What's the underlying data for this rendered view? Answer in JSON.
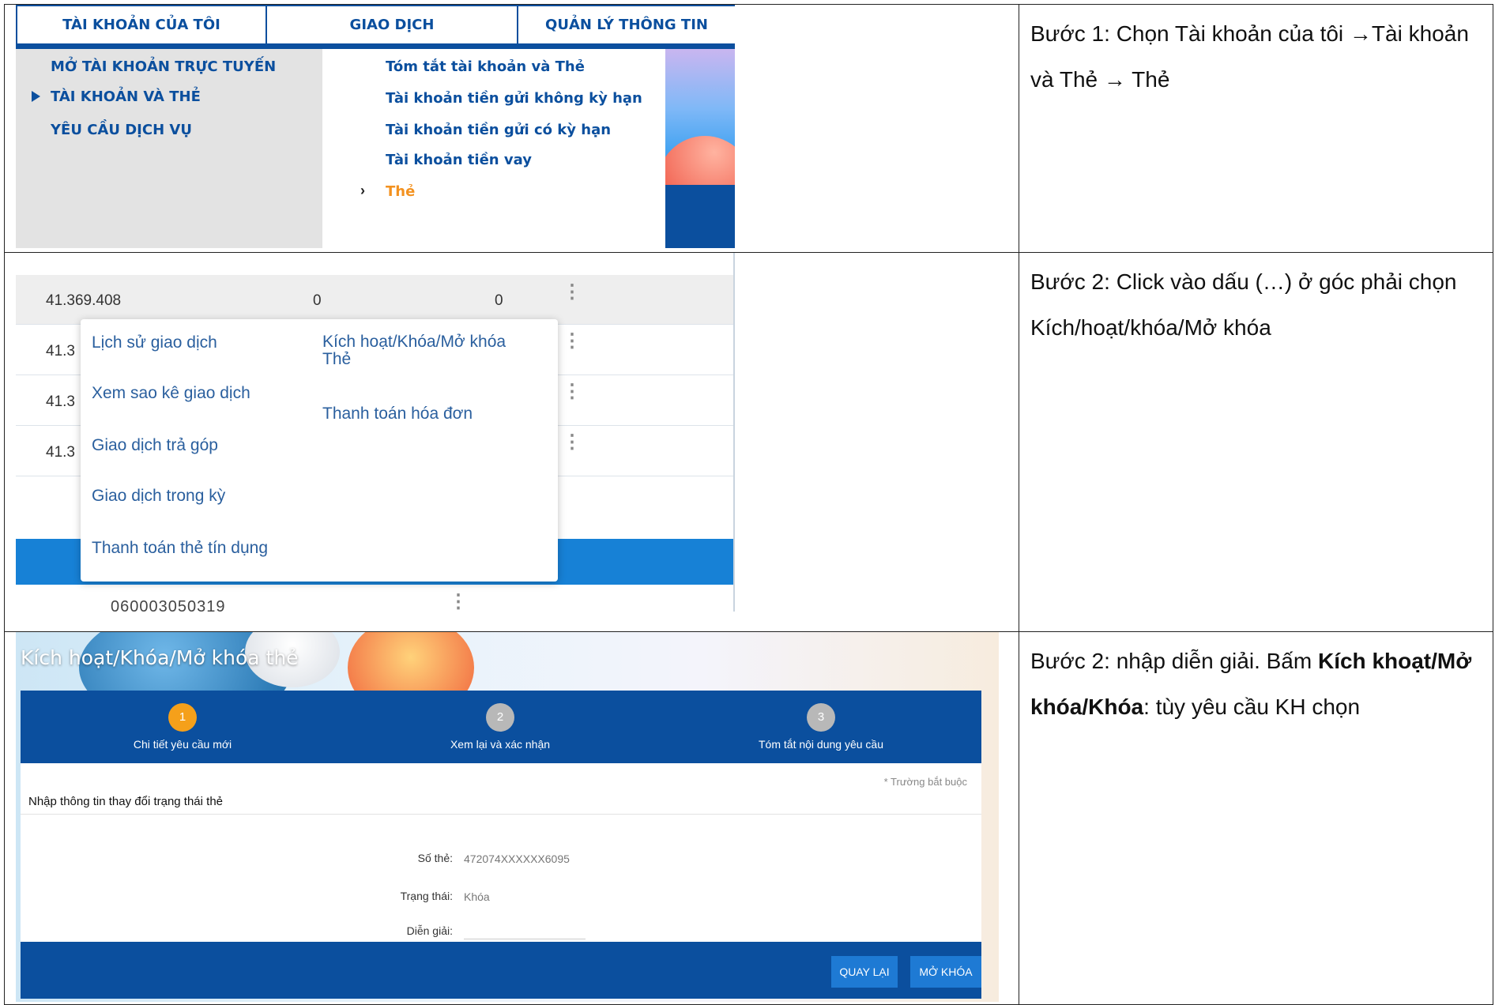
{
  "step1": {
    "instruction": "Bước 1: Chọn Tài khoản của tôi →Tài khoản và Thẻ → Thẻ",
    "tabs": [
      "TÀI KHOẢN CỦA TÔI",
      "GIAO DỊCH",
      "QUẢN LÝ THÔNG TIN"
    ],
    "left_menu": [
      "MỞ TÀI KHOẢN TRỰC TUYẾN",
      "TÀI KHOẢN VÀ THẺ",
      "YÊU CẦU DỊCH VỤ"
    ],
    "right_menu": [
      "Tóm tắt tài khoản và Thẻ",
      "Tài khoản tiền gửi không kỳ hạn",
      "Tài khoản tiền gửi có kỳ hạn",
      "Tài khoản tiền vay",
      "Thẻ"
    ]
  },
  "step2": {
    "instruction": "Bước 2: Click vào dấu (…) ở góc phải chọn Kích/hoạt/khóa/Mở khóa",
    "row_amount": "41.369.408",
    "row_col2": "0",
    "row_col3": "0",
    "row_partial": "41.3",
    "context_left": [
      "Lịch sử giao dịch",
      "Xem sao kê giao dịch",
      "Giao dịch trả góp",
      "Giao dịch trong kỳ",
      "Thanh toán thẻ tín dụng"
    ],
    "context_right": [
      "Kích hoạt/Khóa/Mở khóa Thẻ",
      "Thanh toán hóa đơn"
    ],
    "cut_text": "060003050319"
  },
  "step3": {
    "instruction_prefix": "Bước 2: nhập diễn giải. Bấm ",
    "instruction_bold": "Kích khoạt/Mở khóa/Khóa",
    "instruction_suffix": ": tùy yêu cầu KH chọn",
    "page_title": "Kích hoạt/Khóa/Mở khóa thẻ",
    "steps": [
      {
        "num": "1",
        "label": "Chi tiết yêu cầu mới"
      },
      {
        "num": "2",
        "label": "Xem lại và xác nhận"
      },
      {
        "num": "3",
        "label": "Tóm tắt nội dung yêu cầu"
      }
    ],
    "required_note": "* Trường bắt buộc",
    "section_title": "Nhập thông tin thay đổi trạng thái thẻ",
    "card_label": "Số thẻ:",
    "card_value": "472074XXXXXX6095",
    "status_label": "Trạng thái:",
    "status_value": "Khóa",
    "desc_label": "Diễn giải:",
    "btn_back": "QUAY LẠI",
    "btn_unlock": "MỞ KHÓA"
  }
}
